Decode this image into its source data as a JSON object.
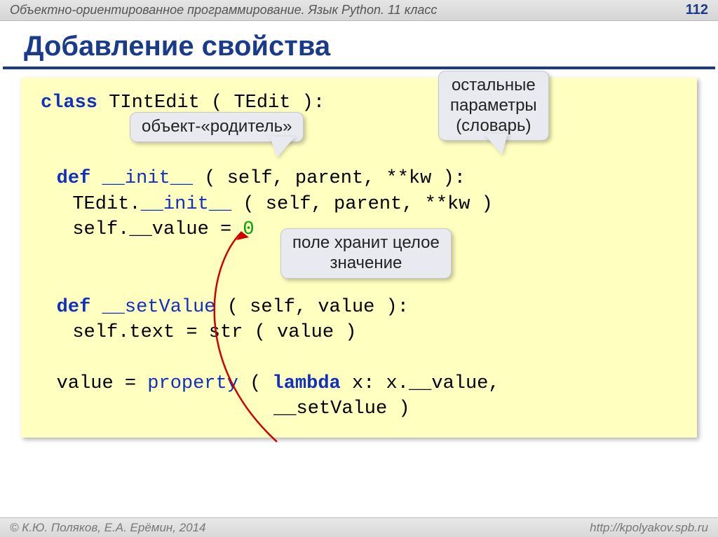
{
  "header": {
    "title": "Объектно-ориентированное программирование. Язык Python. 11 класс",
    "page": "112"
  },
  "slide": {
    "title": "Добавление свойства"
  },
  "callouts": {
    "c1": "объект-«родитель»",
    "c2_line1": "остальные",
    "c2_line2": "параметры",
    "c2_line3": "(словарь)",
    "c3_line1": "поле хранит целое",
    "c3_line2": "значение"
  },
  "code": {
    "l1_kw": "class",
    "l1_rest": " TIntEdit ( TEdit ):",
    "l3_kw": "def",
    "l3_name": " __init__",
    "l3_rest": " ( self, parent, **kw ):",
    "l4": "TEdit.",
    "l4_name": "__init__",
    "l4_rest": " ( self, parent, **kw )",
    "l5a": "self.__value = ",
    "l5b": "0",
    "l7_kw": "def",
    "l7_name": " __setValue",
    "l7_rest": " ( self, value ):",
    "l8": "self.text = str ( value )",
    "l10a": "value = ",
    "l10b": "property",
    "l10c": " ( ",
    "l10d": "lambda",
    "l10e": " x: x.__value,",
    "l11": "__setValue )"
  },
  "footer": {
    "left": "© К.Ю. Поляков, Е.А. Ерёмин, 2014",
    "right": "http://kpolyakov.spb.ru"
  }
}
